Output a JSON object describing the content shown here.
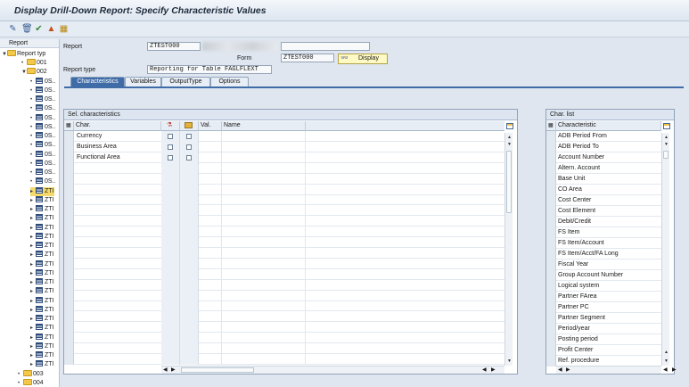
{
  "title": "Display Drill-Down Report: Specify Characteristic Values",
  "toolbar": {
    "icons": [
      "pen-icon",
      "trash-icon",
      "check-icon",
      "transport-icon",
      "layout-icon"
    ]
  },
  "tree": {
    "header": "Report",
    "root": "Report typ",
    "nodes": [
      {
        "label": "001",
        "type": "folder",
        "expanded": false
      },
      {
        "label": "002",
        "type": "folder",
        "expanded": true
      },
      {
        "label": "0S..",
        "type": "report"
      },
      {
        "label": "0S..",
        "type": "report"
      },
      {
        "label": "0S..",
        "type": "report"
      },
      {
        "label": "0S..",
        "type": "report"
      },
      {
        "label": "0S..",
        "type": "report"
      },
      {
        "label": "0S..",
        "type": "report"
      },
      {
        "label": "0S..",
        "type": "report"
      },
      {
        "label": "0S..",
        "type": "report"
      },
      {
        "label": "0S..",
        "type": "report"
      },
      {
        "label": "0S..",
        "type": "report"
      },
      {
        "label": "0S..",
        "type": "report"
      },
      {
        "label": "0S..",
        "type": "report"
      },
      {
        "label": "ZTI",
        "type": "report",
        "selected": true
      },
      {
        "label": "ZTI",
        "type": "report"
      },
      {
        "label": "ZTI",
        "type": "report"
      },
      {
        "label": "ZTI",
        "type": "report"
      },
      {
        "label": "ZTI",
        "type": "report"
      },
      {
        "label": "ZTI",
        "type": "report"
      },
      {
        "label": "ZTI",
        "type": "report"
      },
      {
        "label": "ZTI",
        "type": "report"
      },
      {
        "label": "ZTI",
        "type": "report"
      },
      {
        "label": "ZTI",
        "type": "report"
      },
      {
        "label": "ZTI",
        "type": "report"
      },
      {
        "label": "ZTI",
        "type": "report"
      },
      {
        "label": "ZTI",
        "type": "report"
      },
      {
        "label": "ZTI",
        "type": "report"
      },
      {
        "label": "ZTI",
        "type": "report"
      },
      {
        "label": "ZTI",
        "type": "report"
      },
      {
        "label": "ZTI",
        "type": "report"
      },
      {
        "label": "ZTI",
        "type": "report"
      },
      {
        "label": "ZTI",
        "type": "report"
      },
      {
        "label": "ZTI",
        "type": "report"
      },
      {
        "label": "003",
        "type": "folder",
        "expanded": false
      },
      {
        "label": "004",
        "type": "folder",
        "expanded": false
      }
    ]
  },
  "header": {
    "report_label": "Report",
    "report_value": "ZTEST000",
    "form_label": "Form",
    "form_value": "ZTEST000",
    "display_button": "Display",
    "report_type_label": "Report type",
    "report_type_value": "Reporting for Table FAGLFLEXT"
  },
  "tabs": [
    "Characteristics",
    "Variables",
    "OutputType",
    "Options"
  ],
  "sel_panel": {
    "title": "Sel. characteristics",
    "columns": [
      "Char.",
      "",
      "",
      "Val.",
      "Name"
    ],
    "rows": [
      {
        "char": "Currency"
      },
      {
        "char": "Business Area"
      },
      {
        "char": "Functional Area"
      }
    ]
  },
  "char_list": {
    "title": "Char. list",
    "column": "Characteristic",
    "items": [
      "ADB Period From",
      "ADB Period To",
      "Account Number",
      "Altern. Account",
      "Base Unit",
      "CO Area",
      "Cost Center",
      "Cost Element",
      "Debit/Credit",
      "FS Item",
      "FS Item/Account",
      "FS Item/Acct/FA Long",
      "Fiscal Year",
      "Group Account Number",
      "Logical system",
      "Partner FArea",
      "Partner PC",
      "Partner Segment",
      "Period/year",
      "Posting period",
      "Profit Center",
      "Ref. procedure"
    ]
  }
}
